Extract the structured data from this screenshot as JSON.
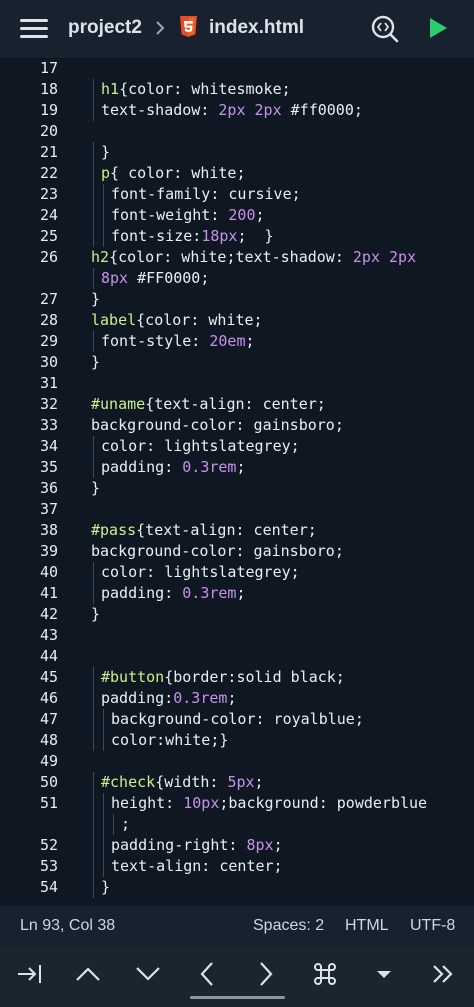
{
  "header": {
    "project": "project2",
    "filename": "index.html",
    "icons": [
      "menu-icon",
      "chevron-right-icon",
      "html5-icon",
      "find-icon",
      "run-icon"
    ]
  },
  "editor": {
    "lines": [
      {
        "n": "17",
        "indent": 0,
        "tokens": []
      },
      {
        "n": "18",
        "indent": 1,
        "tokens": [
          [
            "sel",
            "h1"
          ],
          [
            "p",
            "{color: whitesmoke;"
          ]
        ]
      },
      {
        "n": "19",
        "indent": 1,
        "tokens": [
          [
            "p",
            "text-shadow: "
          ],
          [
            "num",
            "2px 2px"
          ],
          [
            "p",
            " #ff0000;"
          ]
        ]
      },
      {
        "n": "20",
        "indent": 0,
        "tokens": []
      },
      {
        "n": "21",
        "indent": 1,
        "tokens": [
          [
            "p",
            "}"
          ]
        ]
      },
      {
        "n": "22",
        "indent": 1,
        "tokens": [
          [
            "sel",
            "p"
          ],
          [
            "p",
            "{ color: white;"
          ]
        ]
      },
      {
        "n": "23",
        "indent": 2,
        "tokens": [
          [
            "p",
            "font-family: cursive;"
          ]
        ]
      },
      {
        "n": "24",
        "indent": 2,
        "tokens": [
          [
            "p",
            "font-weight: "
          ],
          [
            "num",
            "200"
          ],
          [
            "p",
            ";"
          ]
        ]
      },
      {
        "n": "25",
        "indent": 2,
        "tokens": [
          [
            "p",
            "font-size:"
          ],
          [
            "num",
            "18px"
          ],
          [
            "p",
            ";  }"
          ]
        ]
      },
      {
        "n": "26",
        "indent": 0,
        "tokens": [
          [
            "sel",
            "h2"
          ],
          [
            "p",
            "{color: white;text-shadow: "
          ],
          [
            "num",
            "2px 2px"
          ]
        ]
      },
      {
        "n": "",
        "indent": 1,
        "tokens": [
          [
            "num",
            "8px"
          ],
          [
            "p",
            " #FF0000;"
          ]
        ]
      },
      {
        "n": "27",
        "indent": 0,
        "tokens": [
          [
            "p",
            "}"
          ]
        ]
      },
      {
        "n": "28",
        "indent": 0,
        "tokens": [
          [
            "sel",
            "label"
          ],
          [
            "p",
            "{color: white;"
          ]
        ]
      },
      {
        "n": "29",
        "indent": 1,
        "tokens": [
          [
            "p",
            "font-style: "
          ],
          [
            "num",
            "20em"
          ],
          [
            "p",
            ";"
          ]
        ]
      },
      {
        "n": "30",
        "indent": 0,
        "tokens": [
          [
            "p",
            "}"
          ]
        ]
      },
      {
        "n": "31",
        "indent": 0,
        "tokens": []
      },
      {
        "n": "32",
        "indent": 0,
        "tokens": [
          [
            "sel",
            "#uname"
          ],
          [
            "p",
            "{text-align: center;"
          ]
        ]
      },
      {
        "n": "33",
        "indent": 0,
        "tokens": [
          [
            "p",
            "background-color: gainsboro;"
          ]
        ]
      },
      {
        "n": "34",
        "indent": 1,
        "tokens": [
          [
            "p",
            "color: lightslategrey;"
          ]
        ]
      },
      {
        "n": "35",
        "indent": 1,
        "tokens": [
          [
            "p",
            "padding: "
          ],
          [
            "num",
            "0.3rem"
          ],
          [
            "p",
            ";"
          ]
        ]
      },
      {
        "n": "36",
        "indent": 0,
        "tokens": [
          [
            "p",
            "}"
          ]
        ]
      },
      {
        "n": "37",
        "indent": 0,
        "tokens": []
      },
      {
        "n": "38",
        "indent": 0,
        "tokens": [
          [
            "sel",
            "#pass"
          ],
          [
            "p",
            "{text-align: center;"
          ]
        ]
      },
      {
        "n": "39",
        "indent": 0,
        "tokens": [
          [
            "p",
            "background-color: gainsboro;"
          ]
        ]
      },
      {
        "n": "40",
        "indent": 1,
        "tokens": [
          [
            "p",
            "color: lightslategrey;"
          ]
        ]
      },
      {
        "n": "41",
        "indent": 1,
        "tokens": [
          [
            "p",
            "padding: "
          ],
          [
            "num",
            "0.3rem"
          ],
          [
            "p",
            ";"
          ]
        ]
      },
      {
        "n": "42",
        "indent": 0,
        "tokens": [
          [
            "p",
            "}"
          ]
        ]
      },
      {
        "n": "43",
        "indent": 0,
        "tokens": []
      },
      {
        "n": "44",
        "indent": 0,
        "tokens": []
      },
      {
        "n": "45",
        "indent": 1,
        "tokens": [
          [
            "sel",
            "#button"
          ],
          [
            "p",
            "{border:solid black;"
          ]
        ]
      },
      {
        "n": "46",
        "indent": 1,
        "tokens": [
          [
            "p",
            "padding:"
          ],
          [
            "num",
            "0.3rem"
          ],
          [
            "p",
            ";"
          ]
        ]
      },
      {
        "n": "47",
        "indent": 2,
        "tokens": [
          [
            "p",
            "background-color: royalblue;"
          ]
        ]
      },
      {
        "n": "48",
        "indent": 2,
        "tokens": [
          [
            "p",
            "color:white;}"
          ]
        ]
      },
      {
        "n": "49",
        "indent": 0,
        "tokens": []
      },
      {
        "n": "50",
        "indent": 1,
        "tokens": [
          [
            "sel",
            "#check"
          ],
          [
            "p",
            "{width: "
          ],
          [
            "num",
            "5px"
          ],
          [
            "p",
            ";"
          ]
        ]
      },
      {
        "n": "51",
        "indent": 2,
        "tokens": [
          [
            "p",
            "height: "
          ],
          [
            "num",
            "10px"
          ],
          [
            "p",
            ";background: powderblue"
          ]
        ]
      },
      {
        "n": "",
        "indent": 3,
        "tokens": [
          [
            "p",
            ";"
          ]
        ]
      },
      {
        "n": "52",
        "indent": 2,
        "tokens": [
          [
            "p",
            "padding-right: "
          ],
          [
            "num",
            "8px"
          ],
          [
            "p",
            ";"
          ]
        ]
      },
      {
        "n": "53",
        "indent": 2,
        "tokens": [
          [
            "p",
            "text-align: center;"
          ]
        ]
      },
      {
        "n": "54",
        "indent": 1,
        "tokens": [
          [
            "p",
            "}"
          ]
        ]
      }
    ]
  },
  "status": {
    "position": "Ln 93, Col 38",
    "spaces": "Spaces: 2",
    "language": "HTML",
    "encoding": "UTF-8"
  },
  "keys": [
    "tab-icon",
    "arrow-up-icon",
    "arrow-down-icon",
    "arrow-left-icon",
    "arrow-right-icon",
    "command-icon",
    "dropdown-icon",
    "more-icon"
  ],
  "colors": {
    "selector": "#c8f08f",
    "number": "#c792ea",
    "text": "#e8eef4",
    "run": "#2ecc71"
  }
}
